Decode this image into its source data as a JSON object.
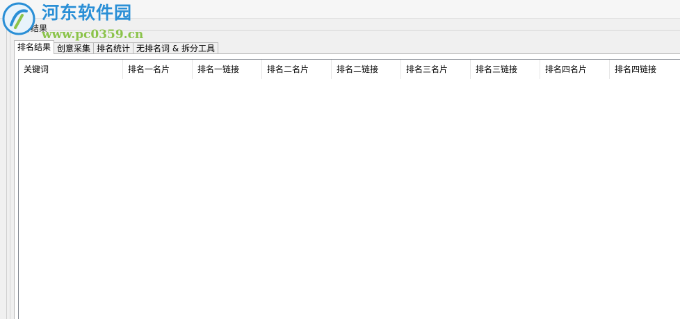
{
  "watermark": {
    "name": "河东软件园",
    "url": "www.pc0359.cn"
  },
  "group": {
    "title": "执行结果"
  },
  "tabs": [
    {
      "label": "排名结果",
      "active": true
    },
    {
      "label": "创意采集",
      "active": false
    },
    {
      "label": "排名统计",
      "active": false
    },
    {
      "label": "无排名词 & 拆分工具",
      "active": false
    }
  ],
  "table": {
    "columns": [
      "关键词",
      "排名一名片",
      "排名一链接",
      "排名二名片",
      "排名二链接",
      "排名三名片",
      "排名三链接",
      "排名四名片",
      "排名四链接"
    ],
    "rows": []
  },
  "colors": {
    "watermark_blue": "#2a8fd6",
    "watermark_green": "#8bc34a"
  }
}
